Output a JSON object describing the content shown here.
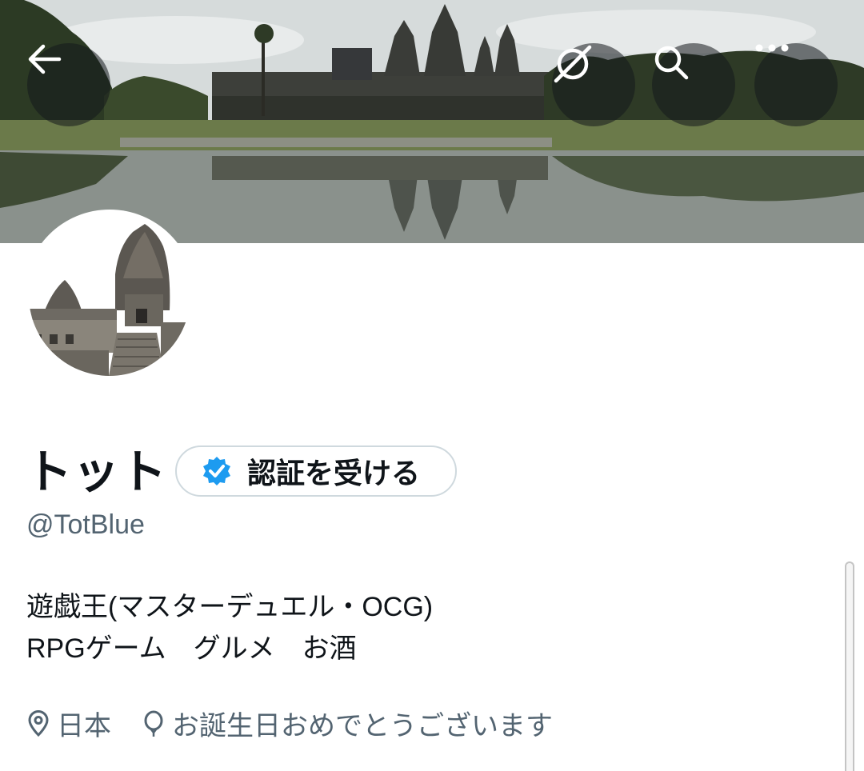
{
  "header": {
    "back_icon": "arrow-left-icon",
    "translate_icon": "no-translate-icon",
    "search_icon": "search-icon",
    "more_icon": "more-horizontal-icon"
  },
  "profile": {
    "display_name": "トット",
    "verify_button_label": "認証を受ける",
    "handle": "@TotBlue",
    "bio_lines": [
      "遊戯王(マスターデュエル・OCG)",
      "RPGゲーム　グルメ　お酒"
    ],
    "location": "日本",
    "birthday": "お誕生日おめでとうございます"
  },
  "colors": {
    "verified_blue": "#1d9bf0",
    "secondary_text": "#536471",
    "primary_text": "#0f1419"
  }
}
